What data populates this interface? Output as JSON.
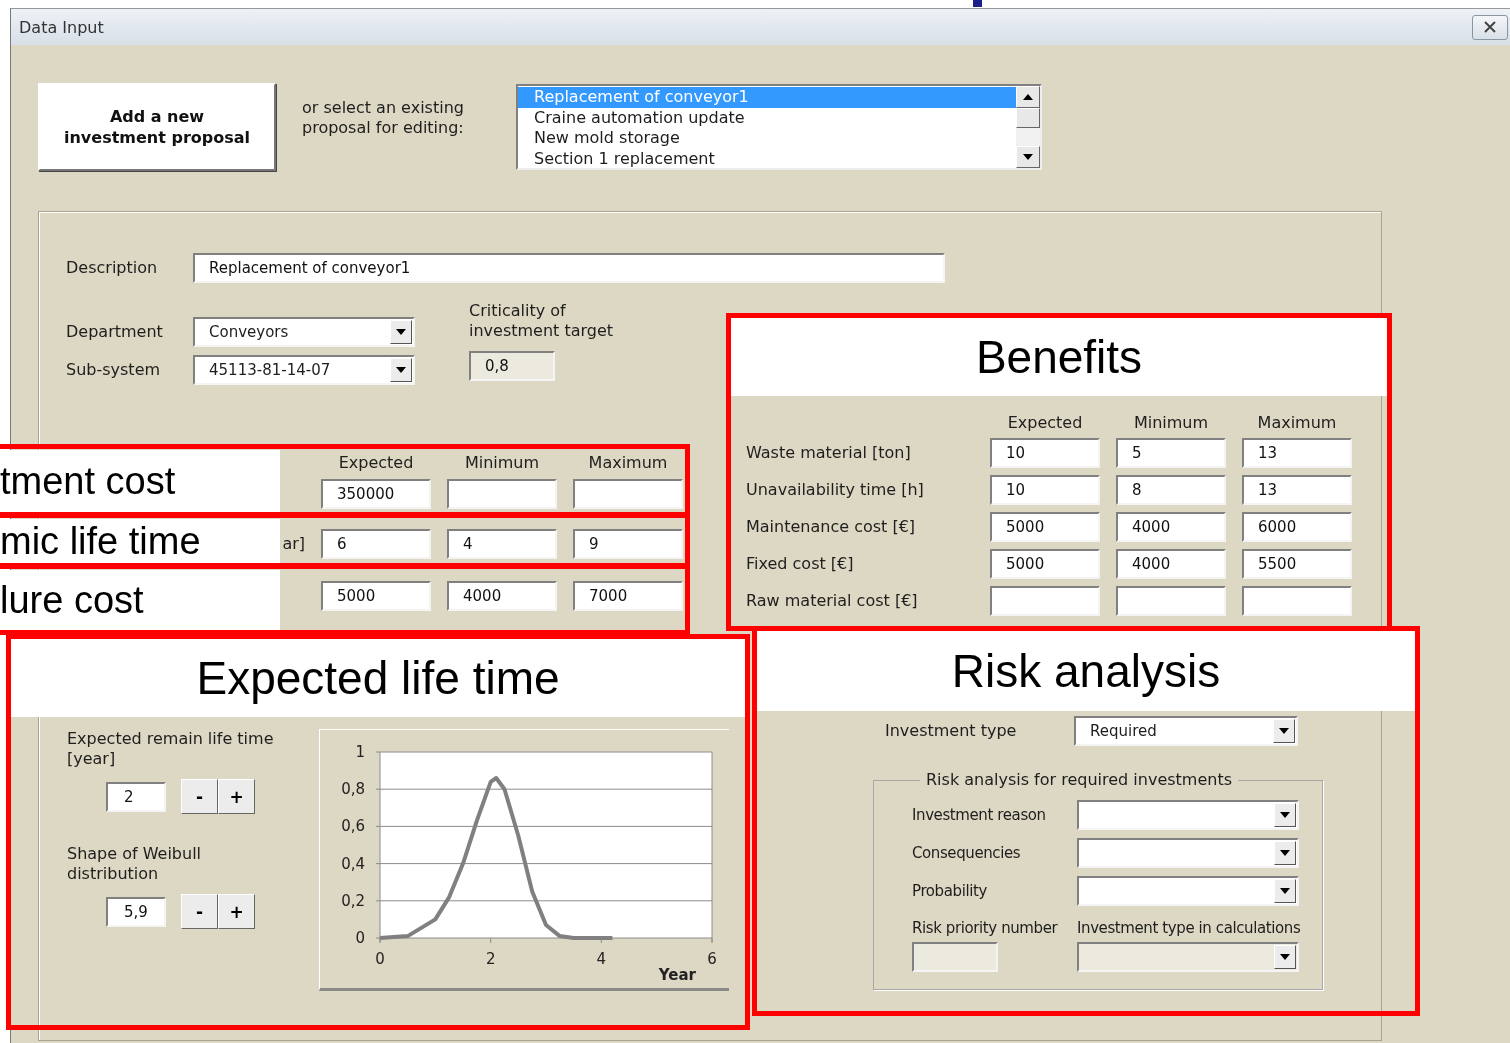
{
  "window": {
    "title": "Data Input"
  },
  "add_button": "Add a new\ninvestment proposal",
  "select_prompt": "or select an existing\nproposal for editing:",
  "proposals": [
    {
      "label": "Replacement of conveyor1",
      "selected": true
    },
    {
      "label": "Craine automation update",
      "selected": false
    },
    {
      "label": "New mold storage",
      "selected": false
    },
    {
      "label": "Section 1 replacement",
      "selected": false
    }
  ],
  "description": {
    "label": "Description",
    "value": "Replacement of conveyor1"
  },
  "department": {
    "label": "Department",
    "value": "Conveyors"
  },
  "subsystem": {
    "label": "Sub-system",
    "value": "45113-81-14-07"
  },
  "criticality": {
    "label": "Criticality of\ninvestment target",
    "value": "0,8",
    "disabled": true
  },
  "cost_table": {
    "columns": [
      "Expected",
      "Minimum",
      "Maximum"
    ],
    "rows": [
      {
        "expected": "350000"
      },
      {
        "label": "ar]",
        "expected": "6",
        "minimum": "4",
        "maximum": "9"
      },
      {
        "expected": "5000",
        "minimum": "4000",
        "maximum": "7000"
      }
    ]
  },
  "benefits": {
    "columns": [
      "Expected",
      "Minimum",
      "Maximum"
    ],
    "rows": [
      {
        "label": "Waste material [ton]",
        "expected": "10",
        "minimum": "5",
        "maximum": "13"
      },
      {
        "label": "Unavailability time [h]",
        "expected": "10",
        "minimum": "8",
        "maximum": "13"
      },
      {
        "label": "Maintenance cost [€]",
        "expected": "5000",
        "minimum": "4000",
        "maximum": "6000"
      },
      {
        "label": "Fixed cost [€]",
        "expected": "5000",
        "minimum": "4000",
        "maximum": "5500"
      },
      {
        "label": "Raw material cost [€]"
      }
    ]
  },
  "life": {
    "remain_label": "Expected remain life time\n[year]",
    "remain_value": "2",
    "shape_label": "Shape of Weibull\ndistribution",
    "shape_value": "5,9",
    "minus": "-",
    "plus": "+",
    "chart_data": {
      "type": "line",
      "grid": true,
      "xlabel": "Year",
      "xlim": [
        0,
        6
      ],
      "ylim": [
        0,
        1
      ],
      "xticks": [
        0,
        2,
        4,
        6
      ],
      "yticks": [
        {
          "value": 0,
          "label": "0"
        },
        {
          "value": 0.2,
          "label": "0,2"
        },
        {
          "value": 0.4,
          "label": "0,4"
        },
        {
          "value": 0.6,
          "label": "0,6"
        },
        {
          "value": 0.8,
          "label": "0,8"
        },
        {
          "value": 1,
          "label": "1"
        }
      ],
      "x": [
        0,
        0.5,
        1,
        1.25,
        1.5,
        1.75,
        2,
        2.1,
        2.25,
        2.5,
        2.75,
        3,
        3.25,
        3.5,
        4,
        4.2
      ],
      "values": [
        0,
        0.01,
        0.1,
        0.22,
        0.4,
        0.63,
        0.84,
        0.86,
        0.8,
        0.55,
        0.25,
        0.07,
        0.01,
        0,
        0,
        0
      ]
    }
  },
  "risk": {
    "type_label": "Investment type",
    "type_value": "Required",
    "group_title": "Risk analysis for required investments",
    "selects": [
      {
        "label": "Investment reason",
        "disabled": false
      },
      {
        "label": "Consequencies",
        "disabled": false
      },
      {
        "label": "Probability",
        "disabled": false
      }
    ],
    "outputs": [
      {
        "label": "Risk priority number",
        "kind": "field",
        "disabled": true
      },
      {
        "label": "Investment type in calculations",
        "kind": "select",
        "disabled": true
      }
    ]
  },
  "callouts": [
    {
      "title": "tment cost",
      "kind": "side"
    },
    {
      "title": "mic life time",
      "kind": "side"
    },
    {
      "title": "lure cost",
      "kind": "side"
    },
    {
      "title": "Expected life time",
      "kind": "top"
    },
    {
      "title": "Benefits",
      "kind": "top"
    },
    {
      "title": "Risk analysis",
      "kind": "top"
    }
  ]
}
